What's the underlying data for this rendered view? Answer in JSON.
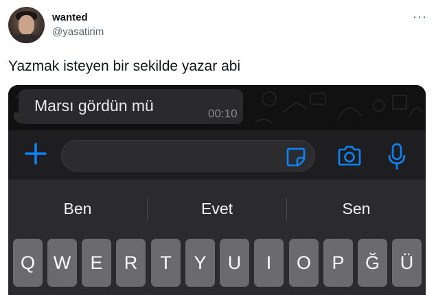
{
  "user": {
    "display_name": "wanted",
    "handle": "@yasatirim"
  },
  "more_icon": "more-dots-icon",
  "tweet": {
    "text": "Yazmak isteyen bir sekilde yazar abi"
  },
  "chat": {
    "message": {
      "text": "Marsı gördün mü",
      "time": "00:10"
    }
  },
  "input_bar": {
    "icons": [
      "plus-icon",
      "sticker-icon",
      "camera-icon",
      "microphone-icon"
    ],
    "accent_color": "#0a84ff"
  },
  "keyboard": {
    "suggestions": [
      "Ben",
      "Evet",
      "Sen"
    ],
    "keys": [
      "Q",
      "W",
      "E",
      "R",
      "T",
      "Y",
      "U",
      "I",
      "O",
      "P",
      "Ğ",
      "Ü"
    ]
  }
}
